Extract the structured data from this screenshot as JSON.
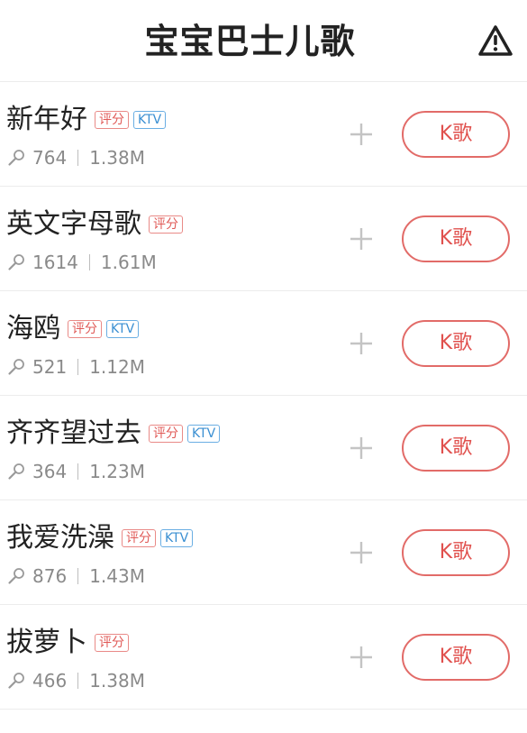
{
  "header": {
    "title": "宝宝巴士儿歌",
    "warning_icon": "warning-triangle-icon"
  },
  "colors": {
    "accent_red": "#e0504d",
    "tag_score": "#e05a57",
    "tag_ktv": "#3a8fd2",
    "meta_gray": "#8a8a8a"
  },
  "songs": [
    {
      "name": "新年好",
      "tags": [
        "评分",
        "KTV"
      ],
      "plays": "764",
      "size": "1.38M",
      "action_label": "K歌"
    },
    {
      "name": "英文字母歌",
      "tags": [
        "评分"
      ],
      "plays": "1614",
      "size": "1.61M",
      "action_label": "K歌"
    },
    {
      "name": "海鸥",
      "tags": [
        "评分",
        "KTV"
      ],
      "plays": "521",
      "size": "1.12M",
      "action_label": "K歌"
    },
    {
      "name": "齐齐望过去",
      "tags": [
        "评分",
        "KTV"
      ],
      "plays": "364",
      "size": "1.23M",
      "action_label": "K歌"
    },
    {
      "name": "我爱洗澡",
      "tags": [
        "评分",
        "KTV"
      ],
      "plays": "876",
      "size": "1.43M",
      "action_label": "K歌"
    },
    {
      "name": "拔萝卜",
      "tags": [
        "评分"
      ],
      "plays": "466",
      "size": "1.38M",
      "action_label": "K歌"
    }
  ]
}
